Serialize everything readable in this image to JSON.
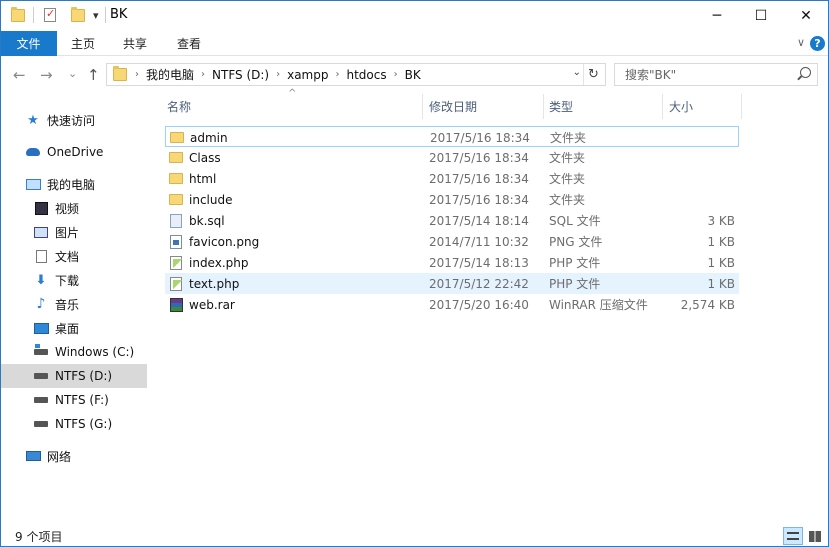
{
  "window": {
    "title": "BK",
    "minimize": "─",
    "maximize": "☐",
    "close": "✕",
    "accent": "#1979ca"
  },
  "quick_access_toolbar": {
    "dropdown": "▾"
  },
  "ribbon": {
    "file_tab": "文件",
    "tabs": [
      "主页",
      "共享",
      "查看"
    ],
    "expand": "∨",
    "help": "?"
  },
  "navigation": {
    "back": "←",
    "forward": "→",
    "recent": "⌄",
    "up": "↑"
  },
  "address": {
    "breadcrumbs": [
      "我的电脑",
      "NTFS (D:)",
      "xampp",
      "htdocs",
      "BK"
    ],
    "separator": "›",
    "dropdown": "⌄",
    "refresh": "↻"
  },
  "search": {
    "placeholder": "搜索\"BK\""
  },
  "sidebar": {
    "items": [
      {
        "label": "快速访问",
        "icon": "star-icon"
      },
      {
        "label": "OneDrive",
        "icon": "cloud-icon"
      },
      {
        "label": "我的电脑",
        "icon": "computer-icon"
      },
      {
        "label": "视频",
        "icon": "video-icon"
      },
      {
        "label": "图片",
        "icon": "pictures-icon"
      },
      {
        "label": "文档",
        "icon": "documents-icon"
      },
      {
        "label": "下载",
        "icon": "downloads-icon"
      },
      {
        "label": "音乐",
        "icon": "music-icon"
      },
      {
        "label": "桌面",
        "icon": "desktop-icon"
      },
      {
        "label": "Windows (C:)",
        "icon": "windows-drive-icon"
      },
      {
        "label": "NTFS (D:)",
        "icon": "drive-icon",
        "selected": true
      },
      {
        "label": "NTFS (F:)",
        "icon": "drive-icon"
      },
      {
        "label": "NTFS (G:)",
        "icon": "drive-icon"
      },
      {
        "label": "网络",
        "icon": "network-icon"
      }
    ]
  },
  "file_list": {
    "columns": [
      "名称",
      "修改日期",
      "类型",
      "大小"
    ],
    "sort_indicator": "^",
    "rows": [
      {
        "name": "admin",
        "date": "2017/5/16 18:34",
        "type": "文件夹",
        "size": "",
        "icon": "folder-icon"
      },
      {
        "name": "Class",
        "date": "2017/5/16 18:34",
        "type": "文件夹",
        "size": "",
        "icon": "folder-icon"
      },
      {
        "name": "html",
        "date": "2017/5/16 18:34",
        "type": "文件夹",
        "size": "",
        "icon": "folder-icon"
      },
      {
        "name": "include",
        "date": "2017/5/16 18:34",
        "type": "文件夹",
        "size": "",
        "icon": "folder-icon"
      },
      {
        "name": "bk.sql",
        "date": "2017/5/14 18:14",
        "type": "SQL 文件",
        "size": "3 KB",
        "icon": "sql-file-icon"
      },
      {
        "name": "favicon.png",
        "date": "2014/7/11 10:32",
        "type": "PNG 文件",
        "size": "1 KB",
        "icon": "png-file-icon"
      },
      {
        "name": "index.php",
        "date": "2017/5/14 18:13",
        "type": "PHP 文件",
        "size": "1 KB",
        "icon": "php-file-icon"
      },
      {
        "name": "text.php",
        "date": "2017/5/12 22:42",
        "type": "PHP 文件",
        "size": "1 KB",
        "icon": "php-file-icon"
      },
      {
        "name": "web.rar",
        "date": "2017/5/20 16:40",
        "type": "WinRAR 压缩文件",
        "size": "2,574 KB",
        "icon": "rar-file-icon"
      }
    ]
  },
  "status": {
    "item_count": "9 个项目"
  }
}
